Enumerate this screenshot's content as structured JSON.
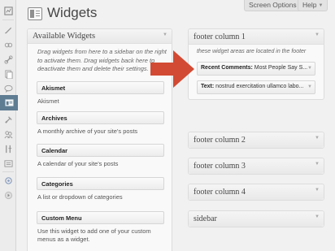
{
  "page": {
    "title": "Widgets"
  },
  "header": {
    "screen_options_label": "Screen Options",
    "help_label": "Help"
  },
  "colors": {
    "accent_arrow": "#d24a33",
    "rail_current": "#5e7c92",
    "panel_bg": "#f9f9f9"
  },
  "rail": {
    "icons": [
      "dashboard-icon",
      "posts-icon",
      "media-icon",
      "links-icon",
      "pages-icon",
      "comments-icon",
      "appearance-icon",
      "plugins-icon",
      "users-icon",
      "tools-icon",
      "settings-icon",
      "extra-icon",
      "collapse-icon"
    ],
    "current": "appearance-icon"
  },
  "available": {
    "title": "Available Widgets",
    "description": "Drag widgets from here to a sidebar on the right to activate them. Drag widgets back here to deactivate them and delete their settings.",
    "widgets": [
      {
        "name": "Akismet",
        "description": "Akismet"
      },
      {
        "name": "Archives",
        "description": "A monthly archive of your site's posts"
      },
      {
        "name": "Calendar",
        "description": "A calendar of your site's posts"
      },
      {
        "name": "Categories",
        "description": "A list or dropdown of categories"
      },
      {
        "name": "Custom Menu",
        "description": "Use this widget to add one of your custom menus as a widget."
      }
    ]
  },
  "sidebars": {
    "footer1": {
      "title": "footer column 1",
      "description": "these widget areas are located in the footer",
      "widgets": [
        {
          "name": "Recent Comments:",
          "detail": "Most People Say S..."
        },
        {
          "name": "Text:",
          "detail": "nostrud exercitation ullamco labo..."
        }
      ]
    },
    "others": [
      {
        "title": "footer column 2"
      },
      {
        "title": "footer column 3"
      },
      {
        "title": "footer column 4"
      },
      {
        "title": "sidebar"
      }
    ]
  }
}
